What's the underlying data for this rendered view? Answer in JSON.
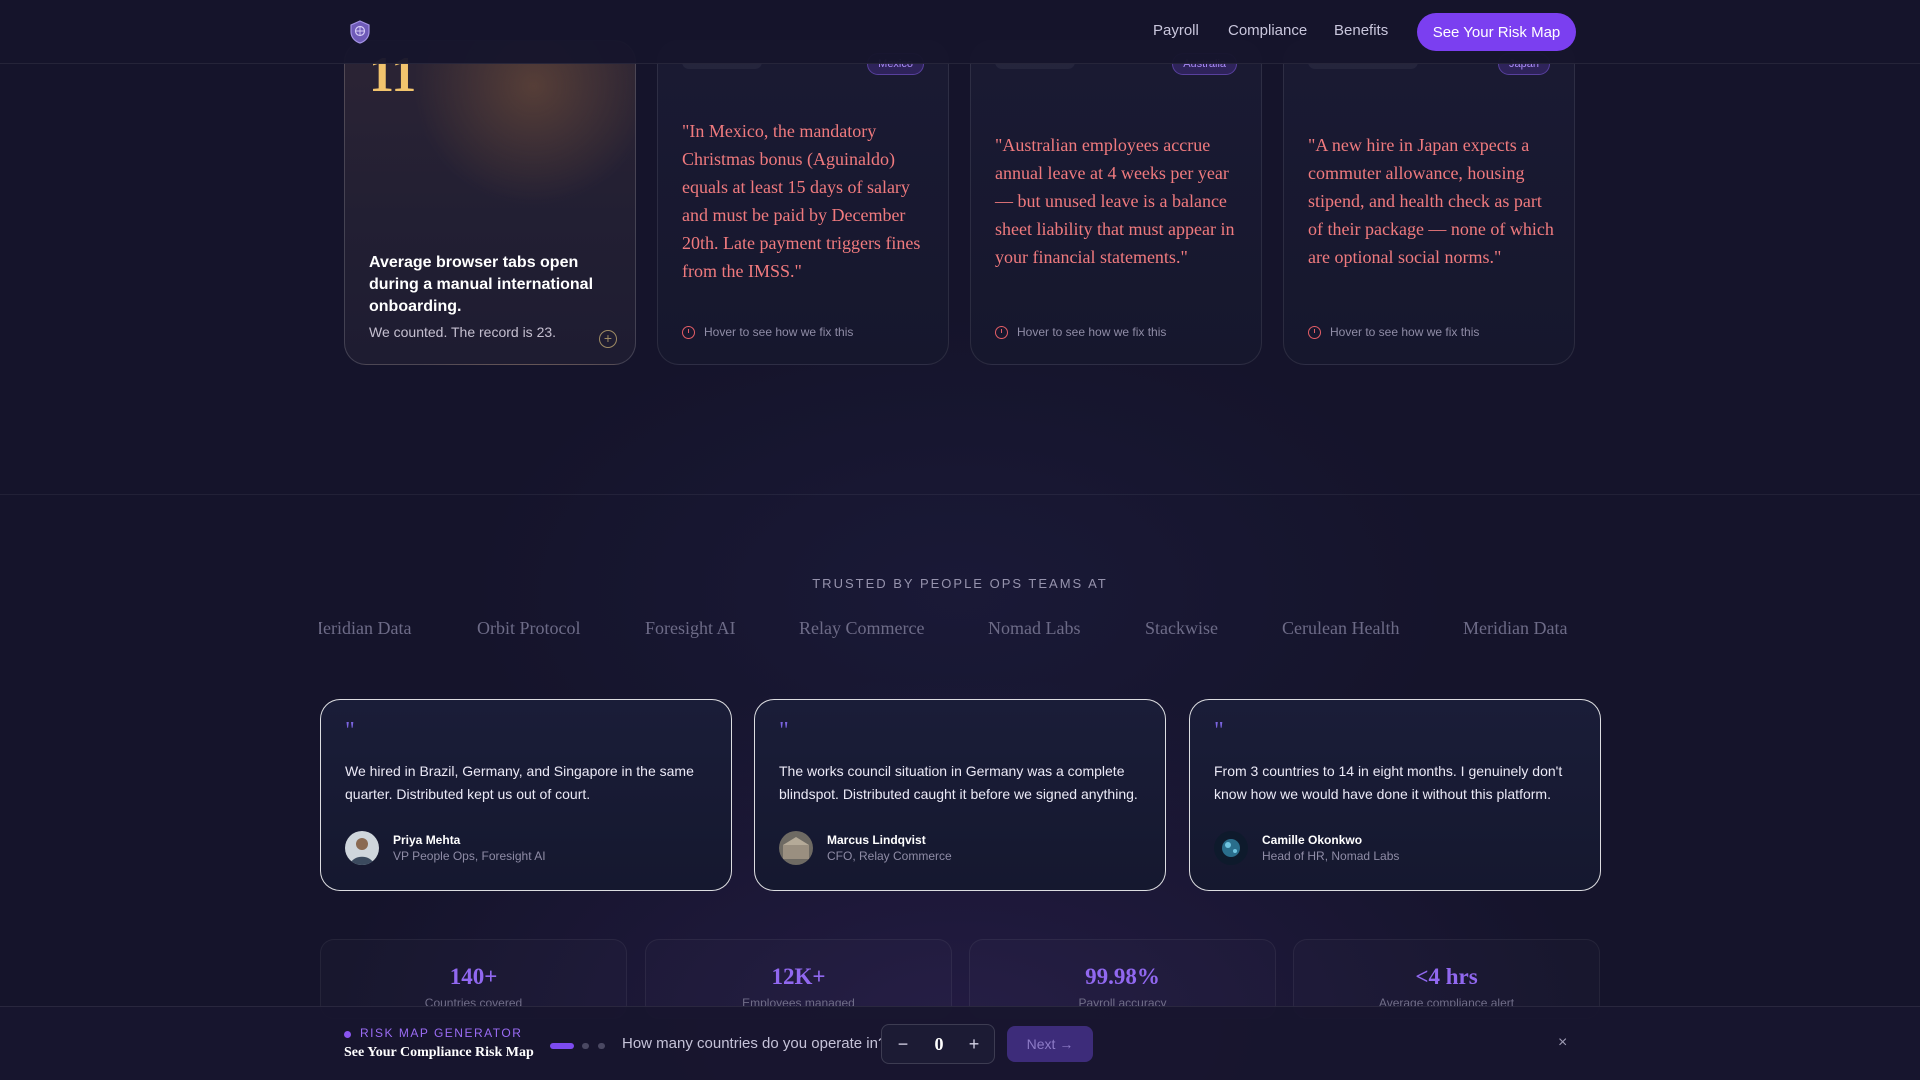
{
  "nav": {
    "logo_icon": "shield-logo-icon",
    "links": [
      "Payroll",
      "Compliance",
      "Benefits"
    ],
    "cta": "See Your Risk Map"
  },
  "fact_cards": {
    "stat": {
      "number": "11",
      "title": "Average browser tabs open during a manual international onboarding.",
      "subtitle": "We counted. The record is 23."
    },
    "mexico": {
      "tag": "Mexico",
      "quote": "\"In Mexico, the mandatory Christmas bonus (Aguinaldo) equals at least 15 days of salary and must be paid by December 20th. Late payment triggers fines from the IMSS.\"",
      "hint": "Hover to see how we fix this"
    },
    "australia": {
      "tag": "Australia",
      "quote": "\"Australian employees accrue annual leave at 4 weeks per year — but unused leave is a balance sheet liability that must appear in your financial statements.\"",
      "hint": "Hover to see how we fix this"
    },
    "japan": {
      "tag": "Japan",
      "quote": "\"A new hire in Japan expects a commuter allowance, housing stipend, and health check as part of their package — none of which are optional social norms.\"",
      "hint": "Hover to see how we fix this"
    }
  },
  "trusted": {
    "label": "TRUSTED BY PEOPLE OPS TEAMS AT",
    "logos": [
      "Meridian Data",
      "Orbit Protocol",
      "Foresight AI",
      "Relay Commerce",
      "Nomad Labs",
      "Stackwise",
      "Cerulean Health",
      "Meridian Data"
    ]
  },
  "testimonials": [
    {
      "quote_mark": "\"",
      "text": "We hired in Brazil, Germany, and Singapore in the same quarter. Distributed kept us out of court.",
      "name": "Priya Mehta",
      "role": "VP People Ops, Foresight AI"
    },
    {
      "quote_mark": "\"",
      "text": "The works council situation in Germany was a complete blindspot. Distributed caught it before we signed anything.",
      "name": "Marcus Lindqvist",
      "role": "CFO, Relay Commerce"
    },
    {
      "quote_mark": "\"",
      "text": "From 3 countries to 14 in eight months. I genuinely don't know how we would have done it without this platform.",
      "name": "Camille Okonkwo",
      "role": "Head of HR, Nomad Labs"
    }
  ],
  "stats": [
    {
      "value": "140+",
      "label": "Countries covered"
    },
    {
      "value": "12K+",
      "label": "Employees managed"
    },
    {
      "value": "99.98%",
      "label": "Payroll accuracy"
    },
    {
      "value": "<4 hrs",
      "label": "Average compliance alert"
    }
  ],
  "risk_bar": {
    "eyebrow": "RISK MAP GENERATOR",
    "title": "See Your Compliance Risk Map",
    "question": "How many countries do you operate in?",
    "minus": "−",
    "plus": "+",
    "value": "0",
    "next": "Next →",
    "close": "×",
    "current_step": 1,
    "total_steps": 3
  },
  "colors": {
    "accent": "#7b3ff0",
    "stat_gold": "#f2c46d",
    "quote_red": "#f07a7e",
    "stat_purple": "#9168f0"
  }
}
